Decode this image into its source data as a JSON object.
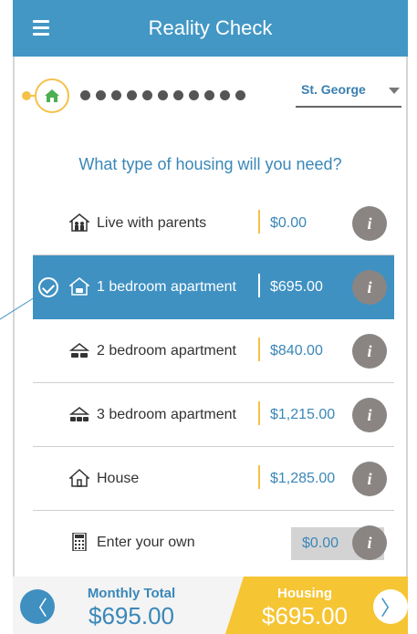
{
  "app": {
    "title": "Reality Check"
  },
  "location": {
    "selected": "St. George"
  },
  "question": "What type of housing will you need?",
  "options": [
    {
      "label": "Live with parents",
      "price": "$0.00",
      "icon": "family-house-icon",
      "selected": false
    },
    {
      "label": "1 bedroom apartment",
      "price": "$695.00",
      "icon": "apartment-car-icon",
      "selected": true
    },
    {
      "label": "2 bedroom apartment",
      "price": "$840.00",
      "icon": "apartment-two-cars-icon",
      "selected": false
    },
    {
      "label": "3 bedroom apartment",
      "price": "$1,215.00",
      "icon": "apartment-three-cars-icon",
      "selected": false
    },
    {
      "label": "House",
      "price": "$1,285.00",
      "icon": "house-icon",
      "selected": false
    }
  ],
  "custom": {
    "label": "Enter your own",
    "value": "$0.00",
    "icon": "calculator-icon"
  },
  "info_label": "i",
  "footer": {
    "monthly_total_label": "Monthly Total",
    "monthly_total_value": "$695.00",
    "category_label": "Housing",
    "category_value": "$695.00",
    "prev": "〈",
    "next": "〉"
  },
  "colors": {
    "header": "#4297c5",
    "accent": "#f4c24a",
    "selected": "#3f91c2",
    "text_blue": "#3a87b8"
  }
}
